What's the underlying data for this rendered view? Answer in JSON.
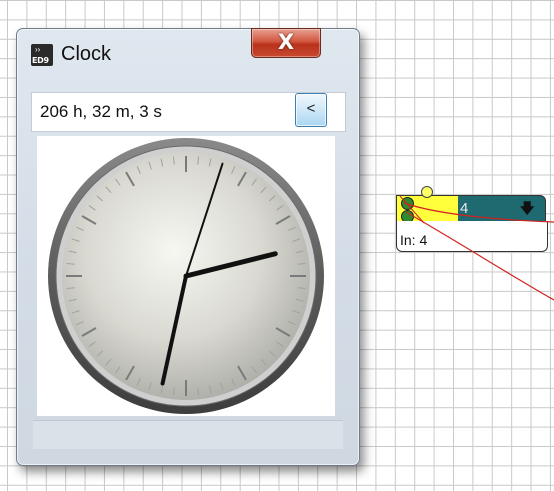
{
  "window": {
    "title": "Clock",
    "icon_name": "ed9-app-icon",
    "icon_label": "ED9",
    "close_label": "X",
    "time_text": "206 h, 32 m, 3 s",
    "back_label": "<"
  },
  "clock": {
    "hours": 206,
    "minutes": 32,
    "seconds": 3
  },
  "node": {
    "number": "4",
    "arrow_icon": "down-arrow-icon",
    "label": "In: 4"
  },
  "colors": {
    "close_button": "#c84a30",
    "node_yellow": "#ffff3c",
    "node_teal": "#1e6a70",
    "port_green": "#2e8a2e",
    "wire_red": "#d42020"
  }
}
